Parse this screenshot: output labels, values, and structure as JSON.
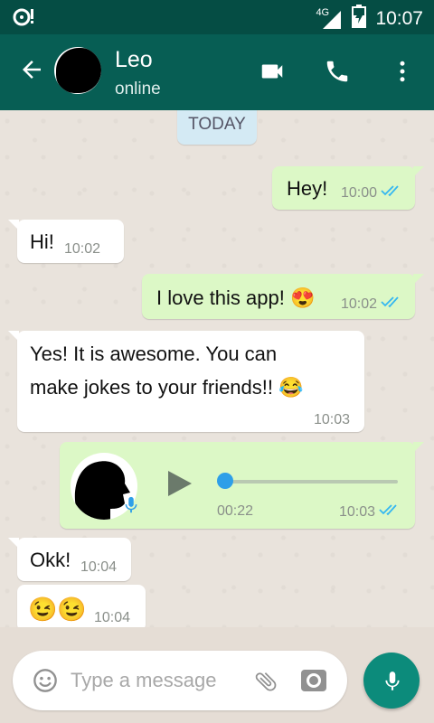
{
  "status_bar": {
    "network": "4G",
    "time": "10:07"
  },
  "header": {
    "name": "Leo",
    "status": "online"
  },
  "chat": {
    "date_chip": "TODAY",
    "messages": [
      {
        "dir": "out",
        "text": "Hey!",
        "time": "10:00"
      },
      {
        "dir": "in",
        "text": "Hi!",
        "time": "10:02"
      },
      {
        "dir": "out",
        "text": "I love this app! 😍",
        "time": "10:02"
      },
      {
        "dir": "in",
        "line1": "Yes! It is awesome. You can",
        "line2": "make jokes to your friends!! 😂",
        "time": "10:03"
      },
      {
        "dir": "out",
        "type": "voice",
        "duration": "00:22",
        "time": "10:03",
        "progress": 0.0
      },
      {
        "dir": "in",
        "text": "Okk!",
        "time": "10:04"
      },
      {
        "dir": "in",
        "text": "😉😉",
        "time": "10:04"
      }
    ]
  },
  "composer": {
    "placeholder": "Type a message"
  },
  "colors": {
    "header": "#075e54",
    "statusbar": "#054d44",
    "outgoing": "#dcf8c6",
    "incoming": "#ffffff",
    "tick_read": "#34b7f1",
    "fab": "#0c8b7b"
  },
  "icons": [
    "back-arrow-icon",
    "video-call-icon",
    "phone-icon",
    "more-vert-icon",
    "emoji-icon",
    "attach-icon",
    "camera-icon",
    "mic-icon",
    "play-icon",
    "double-check-icon"
  ]
}
